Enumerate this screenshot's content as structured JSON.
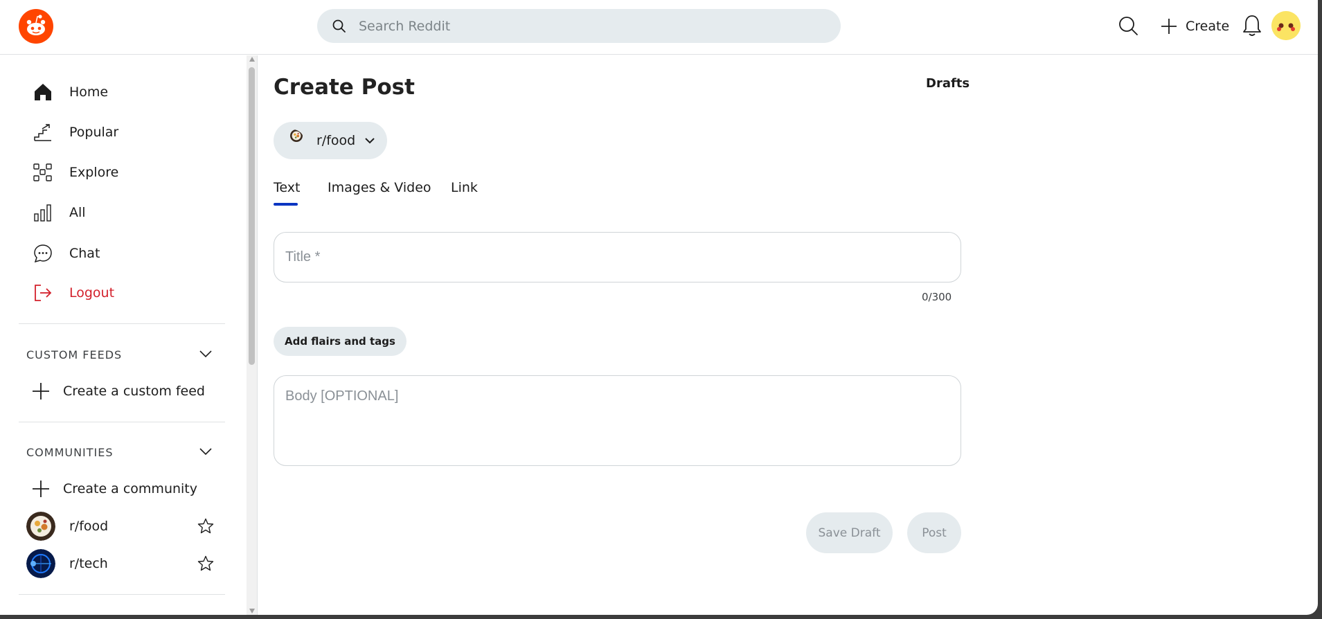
{
  "header": {
    "search_placeholder": "Search Reddit",
    "create_label": "Create"
  },
  "sidebar": {
    "nav": [
      {
        "label": "Home",
        "icon": "home-icon"
      },
      {
        "label": "Popular",
        "icon": "popular-icon"
      },
      {
        "label": "Explore",
        "icon": "explore-icon"
      },
      {
        "label": "All",
        "icon": "all-icon"
      },
      {
        "label": "Chat",
        "icon": "chat-icon"
      },
      {
        "label": "Logout",
        "icon": "logout-icon"
      }
    ],
    "custom_feeds": {
      "title": "CUSTOM FEEDS",
      "create_label": "Create a custom feed"
    },
    "communities": {
      "title": "COMMUNITIES",
      "create_label": "Create a community",
      "items": [
        {
          "name": "r/food"
        },
        {
          "name": "r/tech"
        }
      ]
    }
  },
  "main": {
    "title": "Create Post",
    "drafts_label": "Drafts",
    "selected_community": "r/food",
    "tabs": [
      {
        "label": "Text",
        "active": true
      },
      {
        "label": "Images & Video",
        "active": false
      },
      {
        "label": "Link",
        "active": false
      }
    ],
    "title_placeholder": "Title *",
    "title_value": "",
    "char_counter": "0/300",
    "flair_button": "Add flairs and tags",
    "body_placeholder": "Body [OPTIONAL]",
    "body_value": "",
    "save_draft_label": "Save Draft",
    "post_label": "Post"
  },
  "colors": {
    "brand": "#ff4500",
    "active_tab": "#0b35c2",
    "logout": "#d3202b",
    "pill_bg": "#e5ebee"
  }
}
